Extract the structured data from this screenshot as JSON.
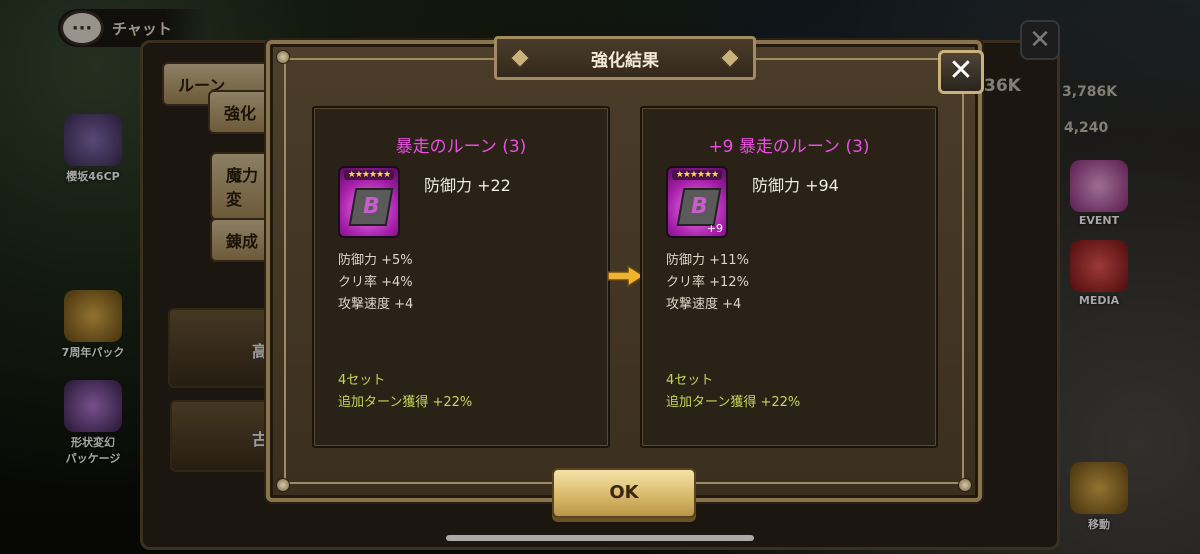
{
  "background": {
    "chat_label": "チャット",
    "tab_rune": "ルーン",
    "tab_enhance": "強化",
    "tab_magic": "魔力変",
    "tab_craft": "錬成",
    "grade_high": "高",
    "grade_ancient": "古",
    "resource_1": "3,786K",
    "resource_2": "4,240",
    "resource_3": "36K",
    "side_items": [
      "櫻坂46CP",
      "7周年パック",
      "形状変幻\nパッケージ"
    ],
    "right_items": [
      "EVENT",
      "MEDIA",
      "移動"
    ]
  },
  "modal": {
    "title": "強化結果",
    "ok_label": "OK",
    "before": {
      "name": "暴走のルーン (3)",
      "main_stat": "防御力 +22",
      "sub_stats": [
        "防御力 +5%",
        "クリ率 +4%",
        "攻撃速度 +4"
      ],
      "set_count": "4セット",
      "set_effect": "追加ターン獲得 +22%",
      "level": ""
    },
    "after": {
      "name": "+9 暴走のルーン (3)",
      "main_stat": "防御力 +94",
      "sub_stats": [
        "防御力 +11%",
        "クリ率 +12%",
        "攻撃速度 +4"
      ],
      "set_count": "4セット",
      "set_effect": "追加ターン獲得 +22%",
      "level": "+9"
    },
    "rune_letter": "B",
    "stars": "★★★★★★"
  },
  "colors": {
    "rune_name": "#e84fe0",
    "set_text": "#c7d45a",
    "ok_button": "#d9ba6c"
  }
}
